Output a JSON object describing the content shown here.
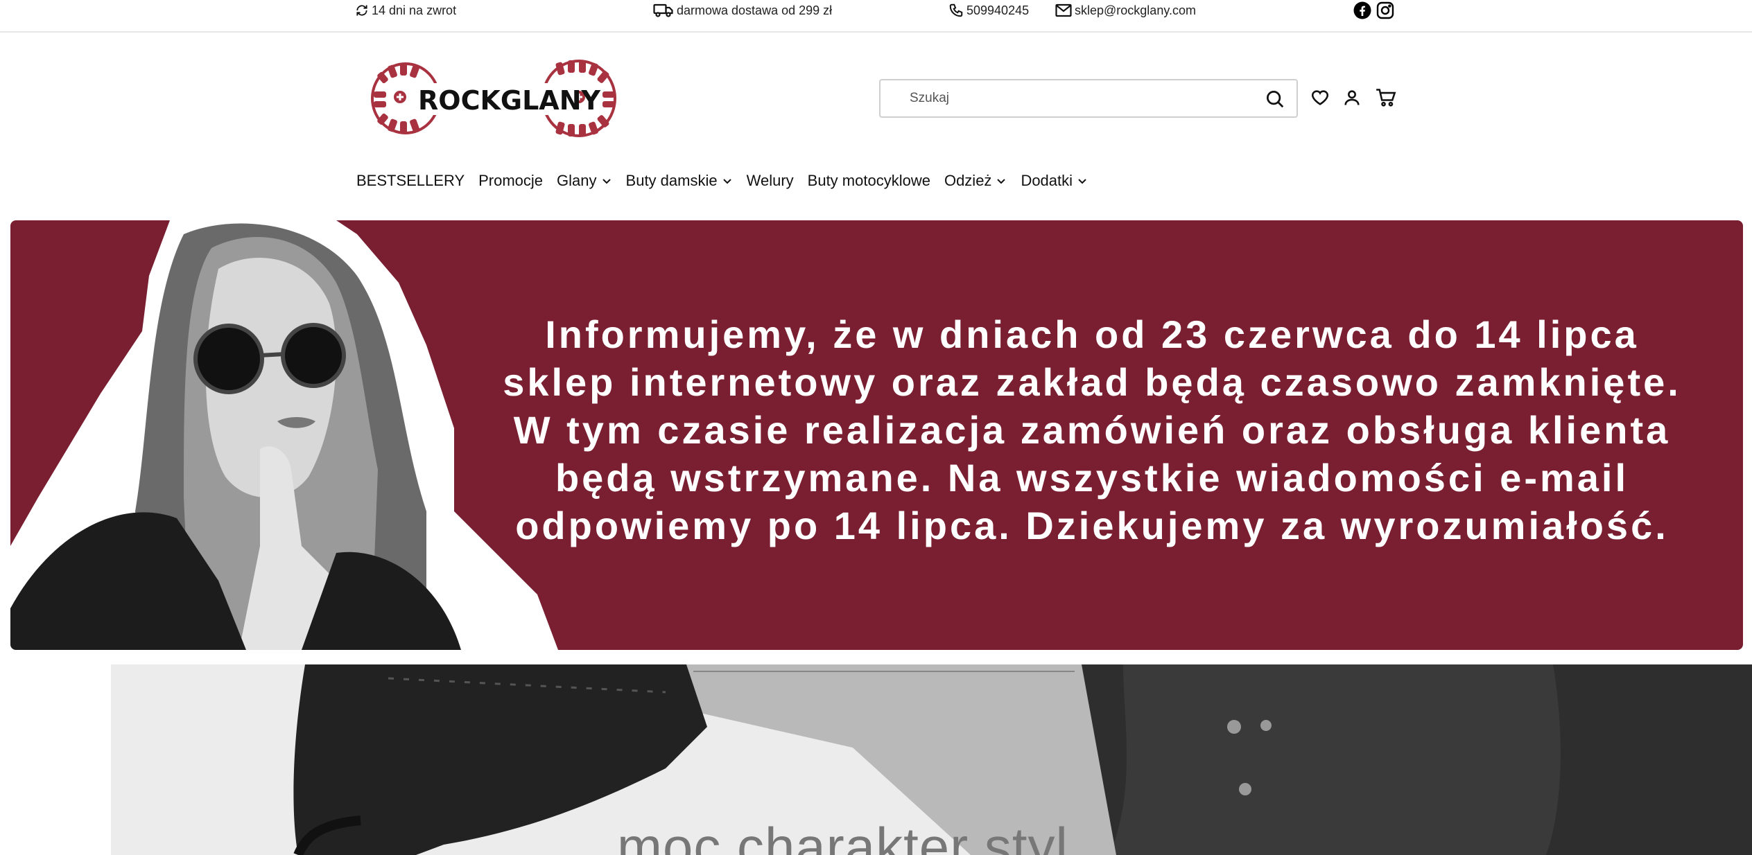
{
  "topbar": {
    "returns": "14 dni na zwrot",
    "delivery": "darmowa dostawa od 299 zł",
    "phone": "509940245",
    "email": "sklep@rockglany.com"
  },
  "header": {
    "logo_text": "ROCKGLANY",
    "search_placeholder": "Szukaj"
  },
  "nav": [
    {
      "label": "BESTSELLERY",
      "dropdown": false
    },
    {
      "label": "Promocje",
      "dropdown": false
    },
    {
      "label": "Glany",
      "dropdown": true
    },
    {
      "label": "Buty damskie",
      "dropdown": true
    },
    {
      "label": "Welury",
      "dropdown": false
    },
    {
      "label": "Buty motocyklowe",
      "dropdown": false
    },
    {
      "label": "Odzież",
      "dropdown": true
    },
    {
      "label": "Dodatki",
      "dropdown": true
    }
  ],
  "banner": {
    "lines": [
      "Informujemy, że w dniach od 23 czerwca do 14 lipca",
      "sklep internetowy oraz zakład będą czasowo zamknięte.",
      "W tym czasie realizacja zamówień oraz obsługa klienta",
      "będą wstrzymane. Na wszystkie wiadomości e-mail",
      "odpowiemy po 14 lipca. Dziekujemy za wyrozumiałość."
    ]
  },
  "hero": {
    "slogan": "moc charakter styl"
  },
  "colors": {
    "banner_bg": "#7a1f31",
    "logo_red": "#a8323f"
  }
}
